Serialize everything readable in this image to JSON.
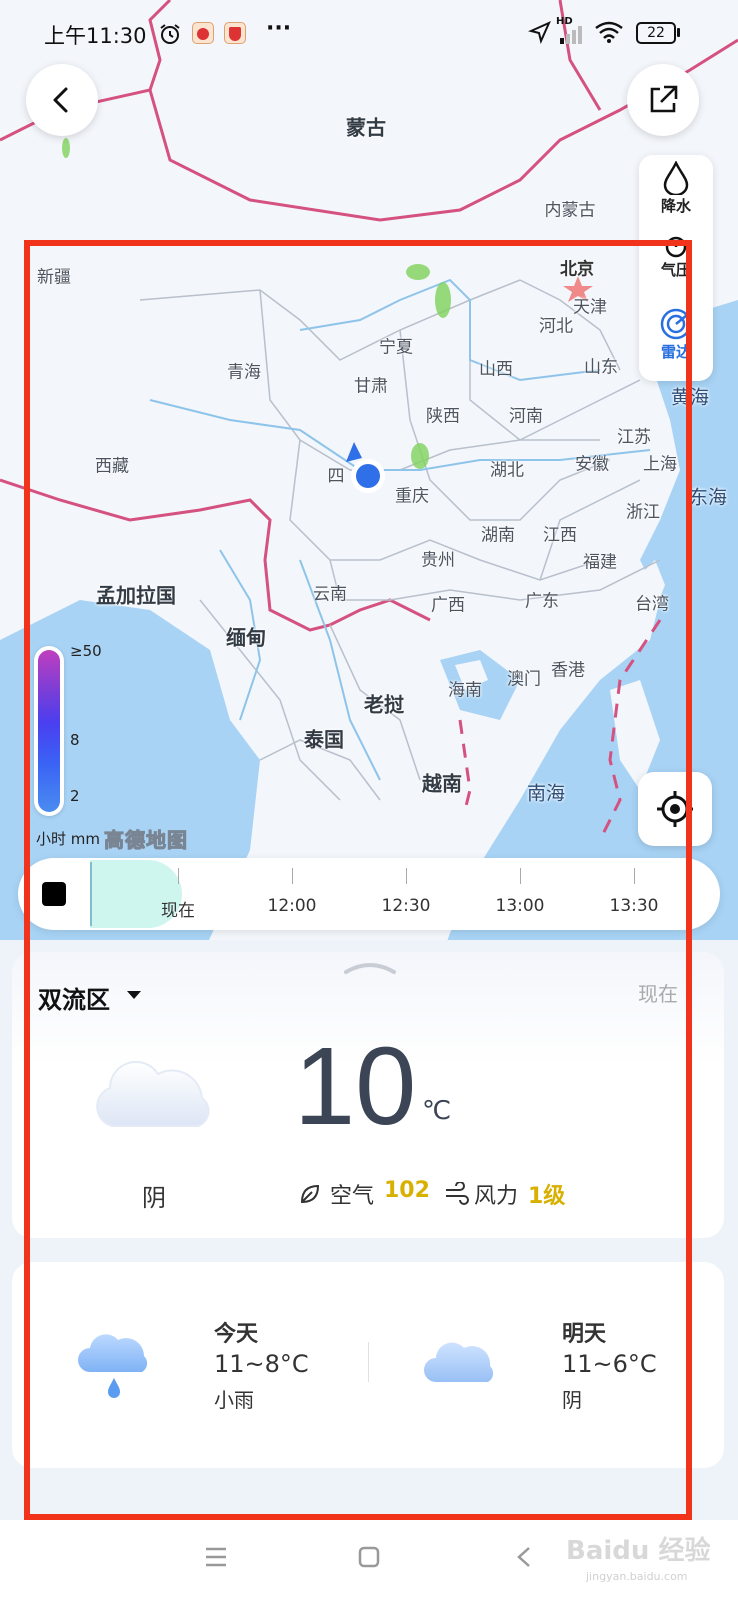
{
  "status_bar": {
    "time": "上午11:30",
    "more": "···",
    "network": "HD",
    "battery": "22"
  },
  "map": {
    "countries": [
      "蒙古",
      "孟加拉国",
      "缅甸",
      "老挝",
      "泰国",
      "越南"
    ],
    "seas": [
      "黄海",
      "东海",
      "南海"
    ],
    "provinces": [
      "新疆",
      "内蒙古",
      "北京",
      "天津",
      "河北",
      "宁夏",
      "山西",
      "山东",
      "青海",
      "甘肃",
      "陕西",
      "河南",
      "江苏",
      "西藏",
      "四",
      "湖北",
      "安徽",
      "上海",
      "重庆",
      "浙江",
      "湖南",
      "江西",
      "贵州",
      "福建",
      "云南",
      "广西",
      "广东",
      "台湾",
      "海南",
      "澳门",
      "香港"
    ],
    "brand": "高德地图",
    "colors": {
      "land": "#f3f6fb",
      "sea": "#a8d3f5",
      "border": "#d5517f",
      "location": "#2f6fe8",
      "rain": "#7fd35c"
    }
  },
  "layers": {
    "precip": "降水",
    "pressure": "气压",
    "radar": "雷达"
  },
  "legend": {
    "max": "≥50",
    "mid": "8",
    "min": "2",
    "unit": "小时 mm"
  },
  "timeline": {
    "now": "现在",
    "times": [
      "12:00",
      "12:30",
      "13:00",
      "13:30"
    ]
  },
  "weather": {
    "location": "双流区",
    "now_label": "现在",
    "temperature": "10",
    "unit": "℃",
    "condition": "阴",
    "aqi_label": "空气",
    "aqi_value": "102",
    "wind_label": "风力",
    "wind_value": "1级",
    "accent": "#e0b500"
  },
  "forecast": [
    {
      "day": "今天",
      "range": "11~8°C",
      "condition": "小雨",
      "icon": "rain-cloud-icon"
    },
    {
      "day": "明天",
      "range": "11~6°C",
      "condition": "阴",
      "icon": "cloud-icon"
    }
  ],
  "watermark": "Baidu 经验",
  "watermark_url": "jingyan.baidu.com"
}
